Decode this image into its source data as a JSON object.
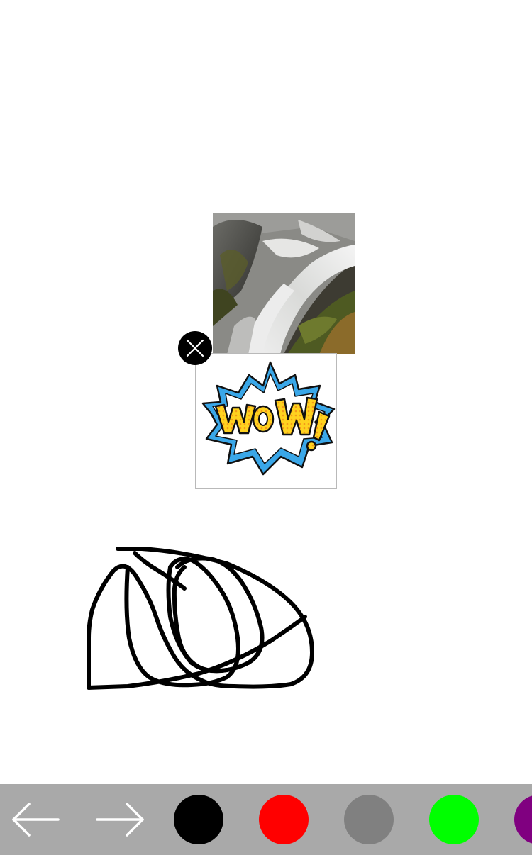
{
  "canvas": {
    "background": "#ffffff"
  },
  "stickers": {
    "photo": {
      "icon": "waterfall-photo"
    },
    "wow": {
      "text": "WoW!",
      "icon": "wow-comic-burst"
    },
    "delete": {
      "icon": "close-icon"
    }
  },
  "drawing": {
    "stroke_color": "#000000"
  },
  "toolbar": {
    "background": "#a9a9a9",
    "undo": {
      "icon": "arrow-left-icon"
    },
    "redo": {
      "icon": "arrow-right-icon"
    },
    "colors": [
      {
        "name": "black",
        "hex": "#000000"
      },
      {
        "name": "red",
        "hex": "#ff0000"
      },
      {
        "name": "gray",
        "hex": "#808080"
      },
      {
        "name": "green",
        "hex": "#00ff00"
      },
      {
        "name": "purple",
        "hex": "#800080"
      }
    ]
  }
}
